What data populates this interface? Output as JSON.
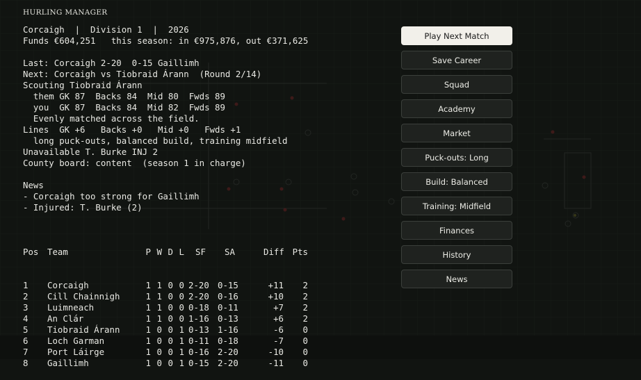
{
  "game": {
    "title": "HURLING MANAGER"
  },
  "status": {
    "header_line": "Corcaigh  |  Division 1  |  2026",
    "funds_line": "Funds €604,251   this season: in €975,876, out €371,625"
  },
  "match": {
    "last": "Last: Corcaigh 2-20  0-15 Gaillimh",
    "next": "Next: Corcaigh vs Tiobraid Árann  (Round 2/14)"
  },
  "scouting": {
    "title": "Scouting Tiobraid Árann",
    "them": "  them GK 87  Backs 84  Mid 80  Fwds 89",
    "you": "  you  GK 87  Backs 84  Mid 82  Fwds 89",
    "summary": "  Evenly matched across the field."
  },
  "lines": {
    "ratings": "Lines  GK +6   Backs +0   Mid +0   Fwds +1",
    "tactics": "  long puck-outs, balanced build, training midfield"
  },
  "unavailable": "Unavailable T. Burke INJ 2",
  "county_board": "County board: content  (season 1 in charge)",
  "news": {
    "title": "News",
    "items": [
      "- Corcaigh too strong for Gaillimh",
      "- Injured: T. Burke (2)"
    ]
  },
  "table": {
    "headers": {
      "pos": "Pos",
      "team": "Team",
      "p": "P",
      "w": "W",
      "d": "D",
      "l": "L",
      "sf": "SF",
      "sa": "SA",
      "diff": "Diff",
      "pts": "Pts"
    },
    "rows": [
      {
        "pos": "1",
        "team": "Corcaigh",
        "p": "1",
        "w": "1",
        "d": "0",
        "l": "0",
        "sf": "2-20",
        "sa": "0-15",
        "diff": "+11",
        "pts": "2"
      },
      {
        "pos": "2",
        "team": "Cill Chainnigh",
        "p": "1",
        "w": "1",
        "d": "0",
        "l": "0",
        "sf": "2-20",
        "sa": "0-16",
        "diff": "+10",
        "pts": "2"
      },
      {
        "pos": "3",
        "team": "Luimneach",
        "p": "1",
        "w": "1",
        "d": "0",
        "l": "0",
        "sf": "0-18",
        "sa": "0-11",
        "diff": "+7",
        "pts": "2"
      },
      {
        "pos": "4",
        "team": "An Clár",
        "p": "1",
        "w": "1",
        "d": "0",
        "l": "0",
        "sf": "1-16",
        "sa": "0-13",
        "diff": "+6",
        "pts": "2"
      },
      {
        "pos": "5",
        "team": "Tiobraid Árann",
        "p": "1",
        "w": "0",
        "d": "0",
        "l": "1",
        "sf": "0-13",
        "sa": "1-16",
        "diff": "-6",
        "pts": "0"
      },
      {
        "pos": "6",
        "team": "Loch Garman",
        "p": "1",
        "w": "0",
        "d": "0",
        "l": "1",
        "sf": "0-11",
        "sa": "0-18",
        "diff": "-7",
        "pts": "0"
      },
      {
        "pos": "7",
        "team": "Port Láirge",
        "p": "1",
        "w": "0",
        "d": "0",
        "l": "1",
        "sf": "0-16",
        "sa": "2-20",
        "diff": "-10",
        "pts": "0"
      },
      {
        "pos": "8",
        "team": "Gaillimh",
        "p": "1",
        "w": "0",
        "d": "0",
        "l": "1",
        "sf": "0-15",
        "sa": "2-20",
        "diff": "-11",
        "pts": "0"
      }
    ]
  },
  "menu": {
    "play_next_match": "Play Next Match",
    "save_career": "Save Career",
    "squad": "Squad",
    "academy": "Academy",
    "market": "Market",
    "puckouts": "Puck-outs: Long",
    "build": "Build: Balanced",
    "training": "Training: Midfield",
    "finances": "Finances",
    "history": "History",
    "news": "News"
  },
  "colors": {
    "background": "#111411",
    "text": "#e9e9e4",
    "button_bg": "#1f221f",
    "primary_button_bg": "#f2f0ea",
    "pitch_markers": "#5a1f1f"
  }
}
